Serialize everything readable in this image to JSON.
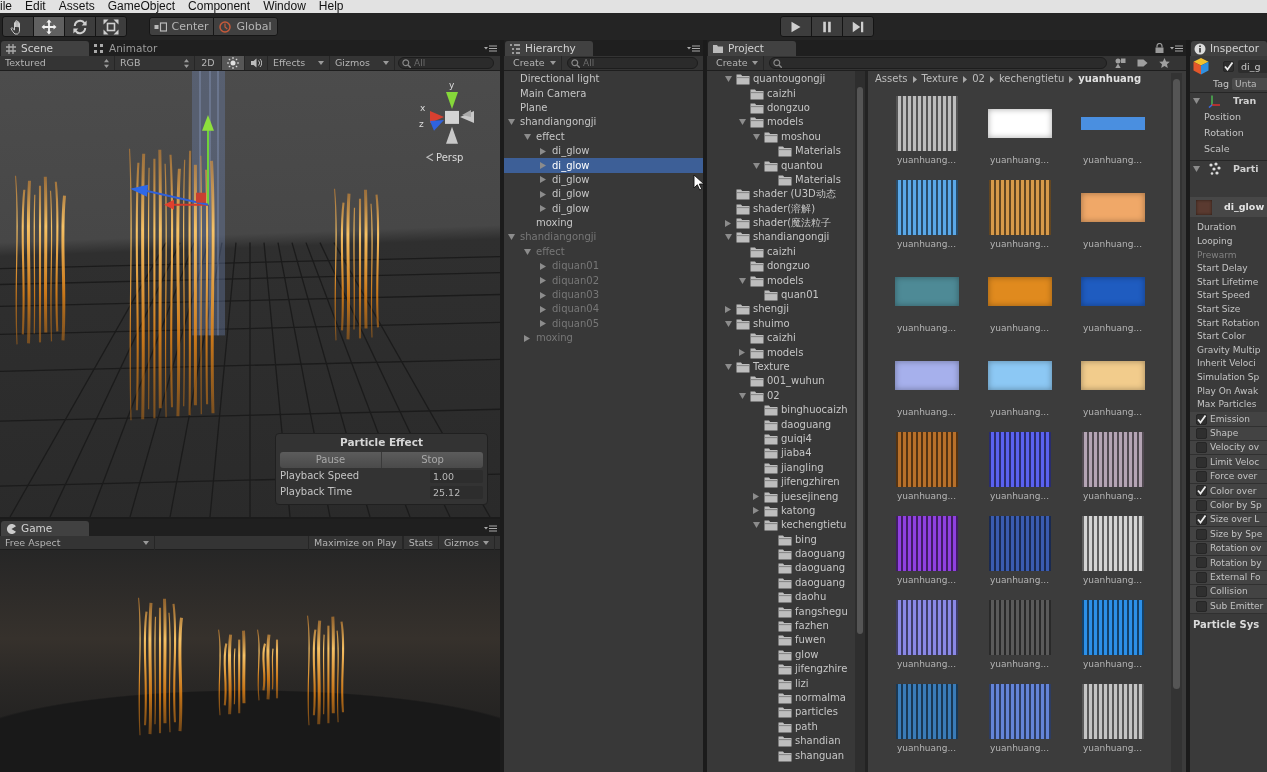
{
  "menu_bar": {
    "items": [
      "ile",
      "Edit",
      "Assets",
      "GameObject",
      "Component",
      "Window",
      "Help"
    ]
  },
  "toolbar": {
    "tools": [
      {
        "kind": "hand",
        "selected": false
      },
      {
        "kind": "move",
        "selected": true
      },
      {
        "kind": "rotate",
        "selected": false
      },
      {
        "kind": "scale",
        "selected": false
      }
    ],
    "pivot_buttons": [
      {
        "kind": "pivot",
        "label": "Center"
      },
      {
        "kind": "space",
        "label": "Global"
      }
    ],
    "playback_buttons": [
      {
        "kind": "play"
      },
      {
        "kind": "pause"
      },
      {
        "kind": "step"
      }
    ]
  },
  "scene": {
    "tabs": [
      {
        "label": "Scene",
        "kind": "scene",
        "selected": true
      },
      {
        "label": "Animator",
        "kind": "animator",
        "selected": false
      }
    ],
    "draw_mode": "Textured",
    "render_mode": "RGB",
    "toggles": [
      {
        "kind": "label",
        "label": "2D",
        "on": false
      },
      {
        "kind": "lighting",
        "on": true
      },
      {
        "kind": "audio",
        "on": false
      }
    ],
    "menus": [
      "Effects",
      "Gizmos"
    ],
    "search": {
      "placeholder": "All"
    },
    "view_gizmo": {
      "axes": [
        "y",
        "x",
        "z"
      ],
      "projection": "Persp"
    },
    "particle_effect": {
      "title": "Particle Effect",
      "buttons": [
        "Pause",
        "Stop"
      ],
      "fields": [
        {
          "label": "Playback Speed",
          "value": "1.00"
        },
        {
          "label": "Playback Time",
          "value": "25.12"
        }
      ]
    }
  },
  "game": {
    "tabs": [
      {
        "label": "Game",
        "kind": "game",
        "selected": true
      }
    ],
    "aspect": "Free Aspect",
    "toggles": [
      {
        "label": "Maximize on Play",
        "on": false
      },
      {
        "label": "Stats",
        "on": false
      }
    ],
    "menus": [
      "Gizmos"
    ]
  },
  "hierarchy": {
    "tabs": [
      {
        "label": "Hierarchy",
        "kind": "hierarchy",
        "selected": true
      }
    ],
    "create": "Create",
    "search": {
      "placeholder": "All"
    },
    "items": [
      {
        "label": "Directional light",
        "active": true,
        "selected": false
      },
      {
        "label": "Main Camera",
        "active": true,
        "selected": false
      },
      {
        "label": "Plane",
        "active": true,
        "selected": false
      },
      {
        "label": "shandiangongji",
        "active": true,
        "selected": false,
        "expanded": true,
        "children": [
          {
            "label": "effect",
            "active": true,
            "selected": false,
            "expanded": true,
            "children": [
              {
                "label": "di_glow",
                "active": true,
                "selected": false,
                "expanded": false
              },
              {
                "label": "di_glow",
                "active": true,
                "selected": true,
                "expanded": false
              },
              {
                "label": "di_glow",
                "active": true,
                "selected": false,
                "expanded": false
              },
              {
                "label": "di_glow",
                "active": true,
                "selected": false,
                "expanded": false
              },
              {
                "label": "di_glow",
                "active": true,
                "selected": false,
                "expanded": false
              }
            ]
          },
          {
            "label": "moxing",
            "active": true,
            "selected": false
          }
        ]
      },
      {
        "label": "shandiangongji",
        "active": false,
        "selected": false,
        "expanded": true,
        "children": [
          {
            "label": "effect",
            "active": false,
            "selected": false,
            "expanded": true,
            "children": [
              {
                "label": "diquan01",
                "active": false,
                "selected": false,
                "expanded": false
              },
              {
                "label": "diquan02",
                "active": false,
                "selected": false,
                "expanded": false
              },
              {
                "label": "diquan03",
                "active": false,
                "selected": false,
                "expanded": false
              },
              {
                "label": "diquan04",
                "active": false,
                "selected": false,
                "expanded": false
              },
              {
                "label": "diquan05",
                "active": false,
                "selected": false,
                "expanded": false
              }
            ]
          },
          {
            "label": "moxing",
            "active": false,
            "selected": false,
            "expanded": false
          }
        ]
      }
    ]
  },
  "project": {
    "tabs": [
      {
        "label": "Project",
        "kind": "project",
        "selected": true
      }
    ],
    "create": "Create",
    "tree": [
      {
        "label": "quantougongji",
        "expanded": true,
        "children": [
          {
            "label": "caizhi"
          },
          {
            "label": "dongzuo"
          },
          {
            "label": "models",
            "expanded": true,
            "children": [
              {
                "label": "moshou",
                "expanded": true,
                "children": [
                  {
                    "label": "Materials"
                  }
                ]
              },
              {
                "label": "quantou",
                "expanded": true,
                "children": [
                  {
                    "label": "Materials"
                  }
                ]
              }
            ]
          }
        ]
      },
      {
        "label": "shader (U3D动态"
      },
      {
        "label": "shader(溶解)"
      },
      {
        "label": "shader(魔法粒子",
        "expanded": false
      },
      {
        "label": "shandiangongji",
        "expanded": true,
        "children": [
          {
            "label": "caizhi"
          },
          {
            "label": "dongzuo"
          },
          {
            "label": "models",
            "expanded": true,
            "children": [
              {
                "label": "quan01"
              }
            ]
          }
        ]
      },
      {
        "label": "shengji",
        "expanded": false
      },
      {
        "label": "shuimo",
        "expanded": true,
        "children": [
          {
            "label": "caizhi"
          },
          {
            "label": "models",
            "expanded": false
          }
        ]
      },
      {
        "label": "Texture",
        "expanded": true,
        "children": [
          {
            "label": "001_wuhun"
          },
          {
            "label": "02",
            "expanded": true,
            "children": [
              {
                "label": "binghuocaizh"
              },
              {
                "label": "daoguang"
              },
              {
                "label": "guiqi4"
              },
              {
                "label": "jiaba4"
              },
              {
                "label": "jiangling"
              },
              {
                "label": "jifengzhiren"
              },
              {
                "label": "juesejineng",
                "expanded": false
              },
              {
                "label": "katong",
                "expanded": false
              },
              {
                "label": "kechengtietu",
                "expanded": true,
                "children": [
                  {
                    "label": "bing"
                  },
                  {
                    "label": "daoguang"
                  },
                  {
                    "label": "daoguang"
                  },
                  {
                    "label": "daoguang"
                  },
                  {
                    "label": "daohu"
                  },
                  {
                    "label": "fangshegu"
                  },
                  {
                    "label": "fazhen"
                  },
                  {
                    "label": "fuwen"
                  },
                  {
                    "label": "glow"
                  },
                  {
                    "label": "jifengzhire"
                  },
                  {
                    "label": "lizi"
                  },
                  {
                    "label": "normalma"
                  },
                  {
                    "label": "particles"
                  },
                  {
                    "label": "path"
                  },
                  {
                    "label": "shandian"
                  },
                  {
                    "label": "shanguan"
                  }
                ]
              }
            ]
          }
        ]
      }
    ],
    "breadcrumb": [
      "Assets",
      "Texture",
      "02",
      "kechengtietu",
      "yuanhuang"
    ],
    "assets": [
      {
        "label": "yuanhuang...",
        "kind": "square",
        "color": "#bdbdbd"
      },
      {
        "label": "yuanhuang...",
        "kind": "wide",
        "color": "#ffffff"
      },
      {
        "label": "yuanhuang...",
        "kind": "strip",
        "color": "#4a8fe0"
      },
      {
        "label": "yuanhuang...",
        "kind": "square",
        "color": "#5aa8e8"
      },
      {
        "label": "yuanhuang...",
        "kind": "square",
        "color": "#d89a4a"
      },
      {
        "label": "yuanhuang...",
        "kind": "wide",
        "color": "#f0a868"
      },
      {
        "label": "yuanhuang...",
        "kind": "wide",
        "color": "#4e8a96"
      },
      {
        "label": "yuanhuang...",
        "kind": "wide",
        "color": "#e08a1e"
      },
      {
        "label": "yuanhuang...",
        "kind": "wide",
        "color": "#1f5cc0"
      },
      {
        "label": "yuanhuang...",
        "kind": "wide",
        "color": "#a6b0ec"
      },
      {
        "label": "yuanhuang...",
        "kind": "wide",
        "color": "#8cc8f4"
      },
      {
        "label": "yuanhuang...",
        "kind": "wide",
        "color": "#f2cc8c"
      },
      {
        "label": "yuanhuang...",
        "kind": "square",
        "color": "#b8702a"
      },
      {
        "label": "yuanhuang...",
        "kind": "square",
        "color": "#5a62f0"
      },
      {
        "label": "yuanhuang...",
        "kind": "square",
        "color": "#b4a4b4"
      },
      {
        "label": "yuanhuang...",
        "kind": "square",
        "color": "#9040e0"
      },
      {
        "label": "yuanhuang...",
        "kind": "square",
        "color": "#3a5cb0"
      },
      {
        "label": "yuanhuang...",
        "kind": "square",
        "color": "#d4d4d4"
      },
      {
        "label": "yuanhuang...",
        "kind": "square",
        "color": "#8a88e6"
      },
      {
        "label": "yuanhuang...",
        "kind": "square",
        "color": "#5a5a5a"
      },
      {
        "label": "yuanhuang...",
        "kind": "square",
        "color": "#2c90e8"
      },
      {
        "label": "yuanhuang...",
        "kind": "square",
        "color": "#3a7cb8"
      },
      {
        "label": "yuanhuang...",
        "kind": "square",
        "color": "#6484d8"
      },
      {
        "label": "yuanhuang...",
        "kind": "square",
        "color": "#c4c4c4"
      }
    ]
  },
  "inspector": {
    "tabs": [
      {
        "label": "Inspector",
        "kind": "inspector",
        "selected": true
      }
    ],
    "object": {
      "active": true,
      "name": "di_g"
    },
    "tag": {
      "label": "Tag",
      "value": "Unta"
    },
    "components": [
      {
        "kind": "transform",
        "title": "Tran",
        "expanded": true,
        "properties": [
          "Position",
          "Rotation",
          "Scale"
        ]
      },
      {
        "kind": "particle",
        "title": "Parti",
        "expanded": true
      }
    ],
    "particle_system": {
      "name": "di_glow",
      "properties": [
        {
          "label": "Duration",
          "disabled": false
        },
        {
          "label": "Looping",
          "disabled": false
        },
        {
          "label": "Prewarm",
          "disabled": true
        },
        {
          "label": "Start Delay",
          "disabled": false
        },
        {
          "label": "Start Lifetime",
          "disabled": false
        },
        {
          "label": "Start Speed",
          "disabled": false
        },
        {
          "label": "Start Size",
          "disabled": false
        },
        {
          "label": "Start Rotation",
          "disabled": false
        },
        {
          "label": "Start Color",
          "disabled": false
        },
        {
          "label": "Gravity Multip",
          "disabled": false
        },
        {
          "label": "Inherit Veloci",
          "disabled": false
        },
        {
          "label": "Simulation Sp",
          "disabled": false
        },
        {
          "label": "Play On Awak",
          "disabled": false
        },
        {
          "label": "Max Particles",
          "disabled": false
        }
      ],
      "modules": [
        {
          "label": "Emission",
          "checked": true
        },
        {
          "label": "Shape",
          "checked": false
        },
        {
          "label": "Velocity ov",
          "checked": false
        },
        {
          "label": "Limit Veloc",
          "checked": false
        },
        {
          "label": "Force over",
          "checked": false
        },
        {
          "label": "Color over",
          "checked": true
        },
        {
          "label": "Color by Sp",
          "checked": false
        },
        {
          "label": "Size over L",
          "checked": true
        },
        {
          "label": "Size by Spe",
          "checked": false
        },
        {
          "label": "Rotation ov",
          "checked": false
        },
        {
          "label": "Rotation by",
          "checked": false
        },
        {
          "label": "External Fo",
          "checked": false
        },
        {
          "label": "Collision",
          "checked": false
        },
        {
          "label": "Sub Emitter",
          "checked": false
        }
      ]
    },
    "footer": "Particle Sys"
  }
}
